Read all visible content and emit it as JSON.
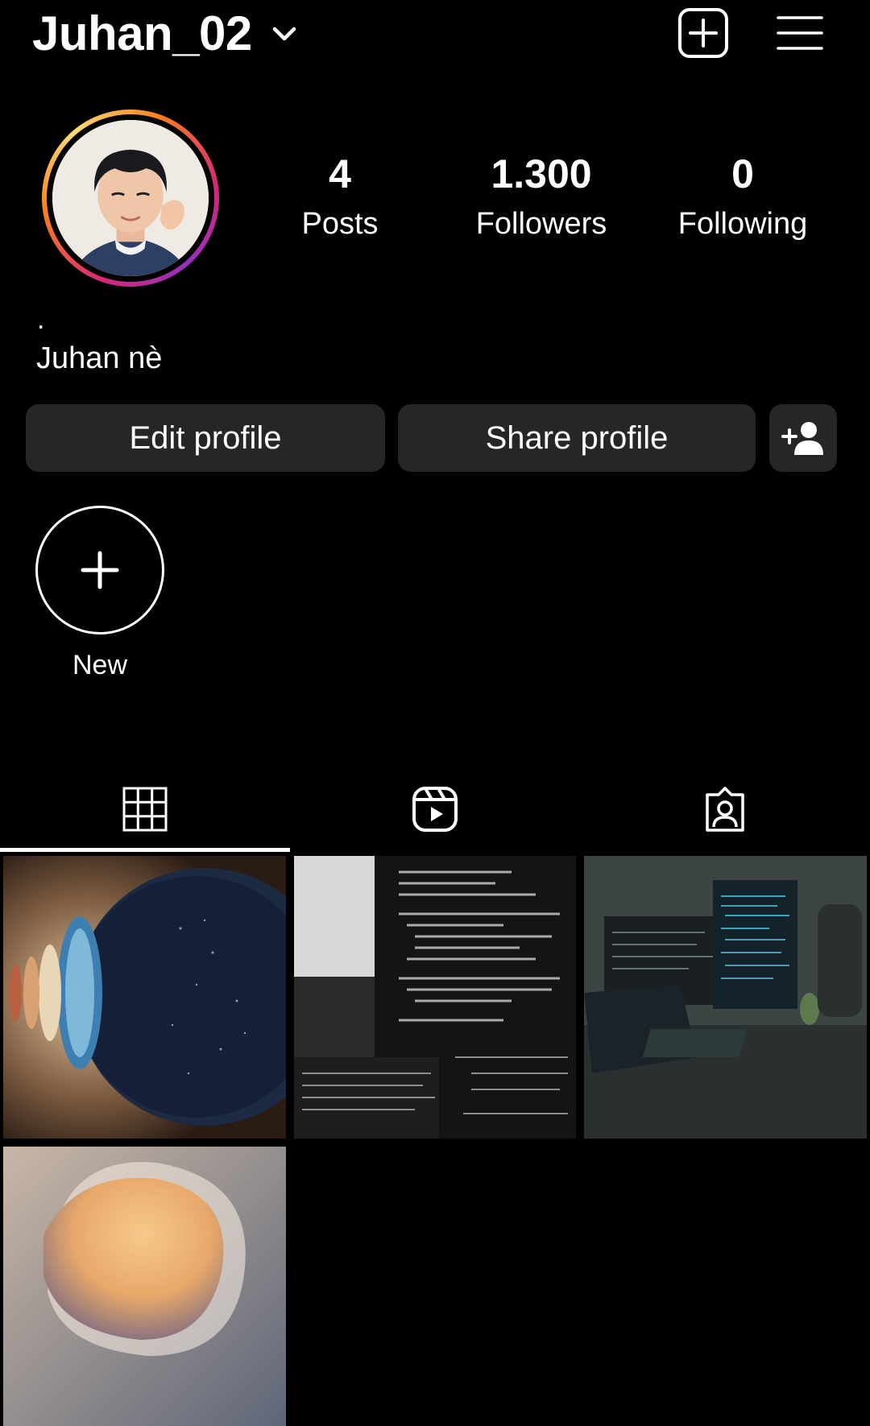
{
  "header": {
    "username": "Juhan_02",
    "icons": [
      "chevron-down-icon",
      "create-post-icon",
      "menu-icon"
    ]
  },
  "profile": {
    "avatar": "profile-photo",
    "stats": [
      {
        "value": "4",
        "label": "Posts"
      },
      {
        "value": "1.300",
        "label": "Followers"
      },
      {
        "value": "0",
        "label": "Following"
      }
    ],
    "bio_dot": ".",
    "bio_name": "Juhan nè"
  },
  "actions": {
    "edit_label": "Edit profile",
    "share_label": "Share profile",
    "add_user_icon": "add-person-icon"
  },
  "highlights": {
    "new_label": "New"
  },
  "tabs": [
    {
      "name": "posts",
      "icon": "grid-icon",
      "active": true
    },
    {
      "name": "reels",
      "icon": "reels-icon",
      "active": false
    },
    {
      "name": "tagged",
      "icon": "tagged-icon",
      "active": false
    }
  ],
  "posts": [
    {
      "name": "planets-wall-photo"
    },
    {
      "name": "code-screen-photo"
    },
    {
      "name": "desk-setup-photo"
    },
    {
      "name": "gradient-shape-photo"
    }
  ],
  "colors": {
    "background": "#000000",
    "button": "#262626",
    "text": "#ffffff"
  }
}
